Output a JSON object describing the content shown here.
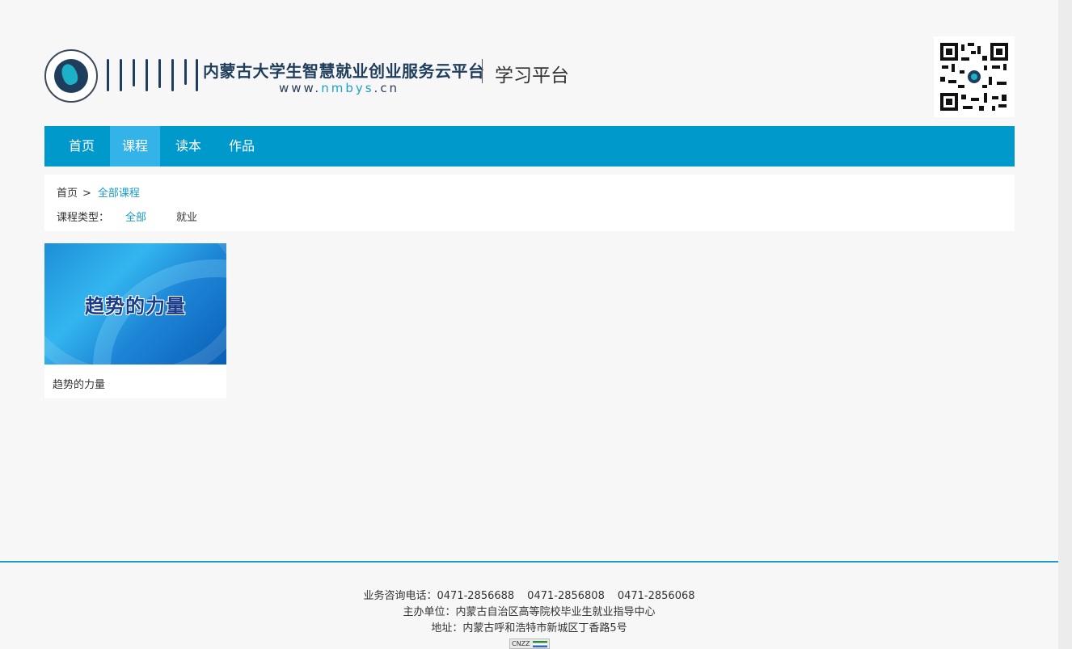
{
  "header": {
    "brand_title": "内蒙古大学生智慧就业创业服务云平台",
    "brand_url_prefix": "www.",
    "brand_url_highlight": "nmbys",
    "brand_url_suffix": ".cn",
    "brand_sub": "学习平台"
  },
  "nav": {
    "items": [
      {
        "label": "首页"
      },
      {
        "label": "课程"
      },
      {
        "label": "读本"
      },
      {
        "label": "作品"
      }
    ],
    "active_index": 1
  },
  "breadcrumb": {
    "home": "首页",
    "separator": ">",
    "current": "全部课程"
  },
  "filter": {
    "type_label": "课程类型：",
    "options": [
      {
        "label": "全部"
      },
      {
        "label": "就业"
      }
    ],
    "active_index": 0
  },
  "courses": [
    {
      "thumbnail_text": "趋势的力量",
      "title": "趋势的力量"
    }
  ],
  "footer": {
    "phone_label": "业务咨询电话：",
    "phones": [
      "0471-2856688",
      "0471-2856808",
      "0471-2856068"
    ],
    "host": "主办单位：内蒙古自治区高等院校毕业生就业指导中心",
    "address": "地址：内蒙古呼和浩特市新城区丁香路5号",
    "badge_text": "CNZZ"
  },
  "colors": {
    "nav_bg": "#0099cc",
    "nav_active": "#34b3e8",
    "link": "#1a9bc4",
    "footer_line": "#1d9bc8"
  }
}
